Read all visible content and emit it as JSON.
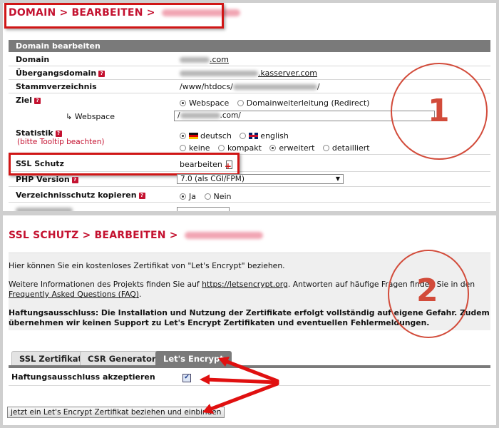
{
  "panel1": {
    "breadcrumb": "DOMAIN > BEARBEITEN >",
    "section_title": "Domain bearbeiten",
    "rows": {
      "domain": {
        "label": "Domain",
        "value_suffix": ".com"
      },
      "uebergang": {
        "label": "Übergangsdomain",
        "value_suffix": ".kasserver.com"
      },
      "stamm": {
        "label": "Stammverzeichnis",
        "value_prefix": "/www/htdocs/",
        "value_suffix": "/"
      },
      "ziel": {
        "label": "Ziel",
        "opt_webspace": "Webspace",
        "opt_redirect": "Domainweiterleitung (Redirect)"
      },
      "webspace": {
        "label": "↳ Webspace",
        "value_prefix": "/",
        "value_suffix": ".com/"
      },
      "statistik": {
        "label": "Statistik",
        "sublabel": "(bitte Tooltip beachten)",
        "lang_de": "deutsch",
        "lang_en": "english",
        "opt_keine": "keine",
        "opt_kompakt": "kompakt",
        "opt_erweitert": "erweitert",
        "opt_detailliert": "detailliert"
      },
      "ssl": {
        "label": "SSL Schutz",
        "action": "bearbeiten"
      },
      "php": {
        "label": "PHP Version",
        "selected": "7.0 (als CGI/FPM)"
      },
      "verz": {
        "label": "Verzeichnisschutz kopieren",
        "opt_ja": "Ja",
        "opt_nein": "Nein"
      }
    },
    "annotation_number": "1"
  },
  "panel2": {
    "breadcrumb": "SSL SCHUTZ > BEARBEITEN >",
    "intro": "Hier können Sie ein kostenloses Zertifikat von \"Let's Encrypt\" beziehen.",
    "info_pre": "Weitere Informationen des Projekts finden Sie auf ",
    "info_link1": "https://letsencrypt.org",
    "info_mid": ". Antworten auf häufige Fragen finden Sie in den ",
    "info_link2": "Frequently Asked Questions (FAQ)",
    "info_end": ".",
    "disclaimer": "Haftungsausschluss: Die Installation und Nutzung der Zertifikate erfolgt vollständig auf eigene Gefahr. Zudem übernehmen wir keinen Support zu Let's Encrypt Zertifikaten und eventuellen Fehlermeldungen.",
    "tabs": [
      "SSL Zertifikat",
      "CSR Generator",
      "Let's Encrypt"
    ],
    "accept_label": "Haftungsausschluss akzeptieren",
    "submit_label": "jetzt ein Let's Encrypt Zertifikat beziehen und einbinden",
    "annotation_number": "2"
  },
  "colors": {
    "accent": "#c41230",
    "annotation": "#d01616",
    "header_bg": "#7a7a7a"
  }
}
